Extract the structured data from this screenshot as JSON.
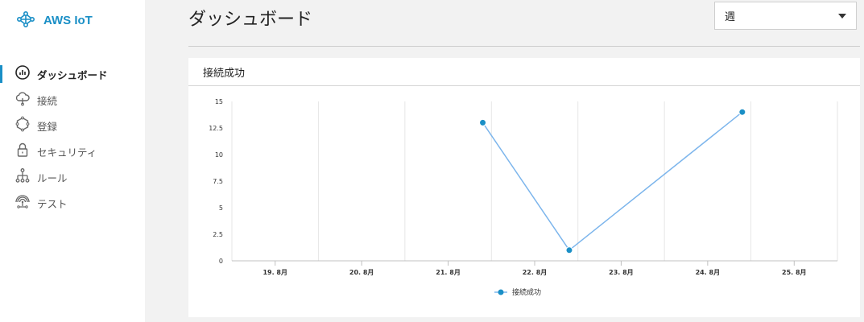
{
  "brand": {
    "name": "AWS IoT",
    "icon": "aws-iot-logo-icon",
    "color": "#1a8fc6"
  },
  "sidebar": {
    "items": [
      {
        "label": "ダッシュボード",
        "icon": "dashboard-gauge-icon",
        "active": true
      },
      {
        "label": "接続",
        "icon": "cloud-connect-icon",
        "active": false
      },
      {
        "label": "登録",
        "icon": "hexagon-nodes-icon",
        "active": false
      },
      {
        "label": "セキュリティ",
        "icon": "lock-icon",
        "active": false
      },
      {
        "label": "ルール",
        "icon": "rules-tree-icon",
        "active": false
      },
      {
        "label": "テスト",
        "icon": "broadcast-antenna-icon",
        "active": false
      }
    ]
  },
  "header": {
    "title": "ダッシュボード",
    "range_select": {
      "value": "週"
    }
  },
  "panel": {
    "title": "接続成功"
  },
  "chart_data": {
    "type": "line",
    "categories": [
      "19. 8月",
      "20. 8月",
      "21. 8月",
      "22. 8月",
      "23. 8月",
      "24. 8月",
      "25. 8月"
    ],
    "yticks": [
      "0",
      "2.5",
      "5",
      "7.5",
      "10",
      "12.5",
      "15"
    ],
    "ylim": [
      0,
      15
    ],
    "grid": "vertical",
    "series": [
      {
        "name": "接続成功",
        "color": "#7cb5ec",
        "marker_color": "#1a8fc6",
        "points": [
          {
            "x": 21.4,
            "y": 13
          },
          {
            "x": 22.4,
            "y": 1
          },
          {
            "x": 24.4,
            "y": 14
          }
        ]
      }
    ],
    "legend": "bottom-center"
  }
}
